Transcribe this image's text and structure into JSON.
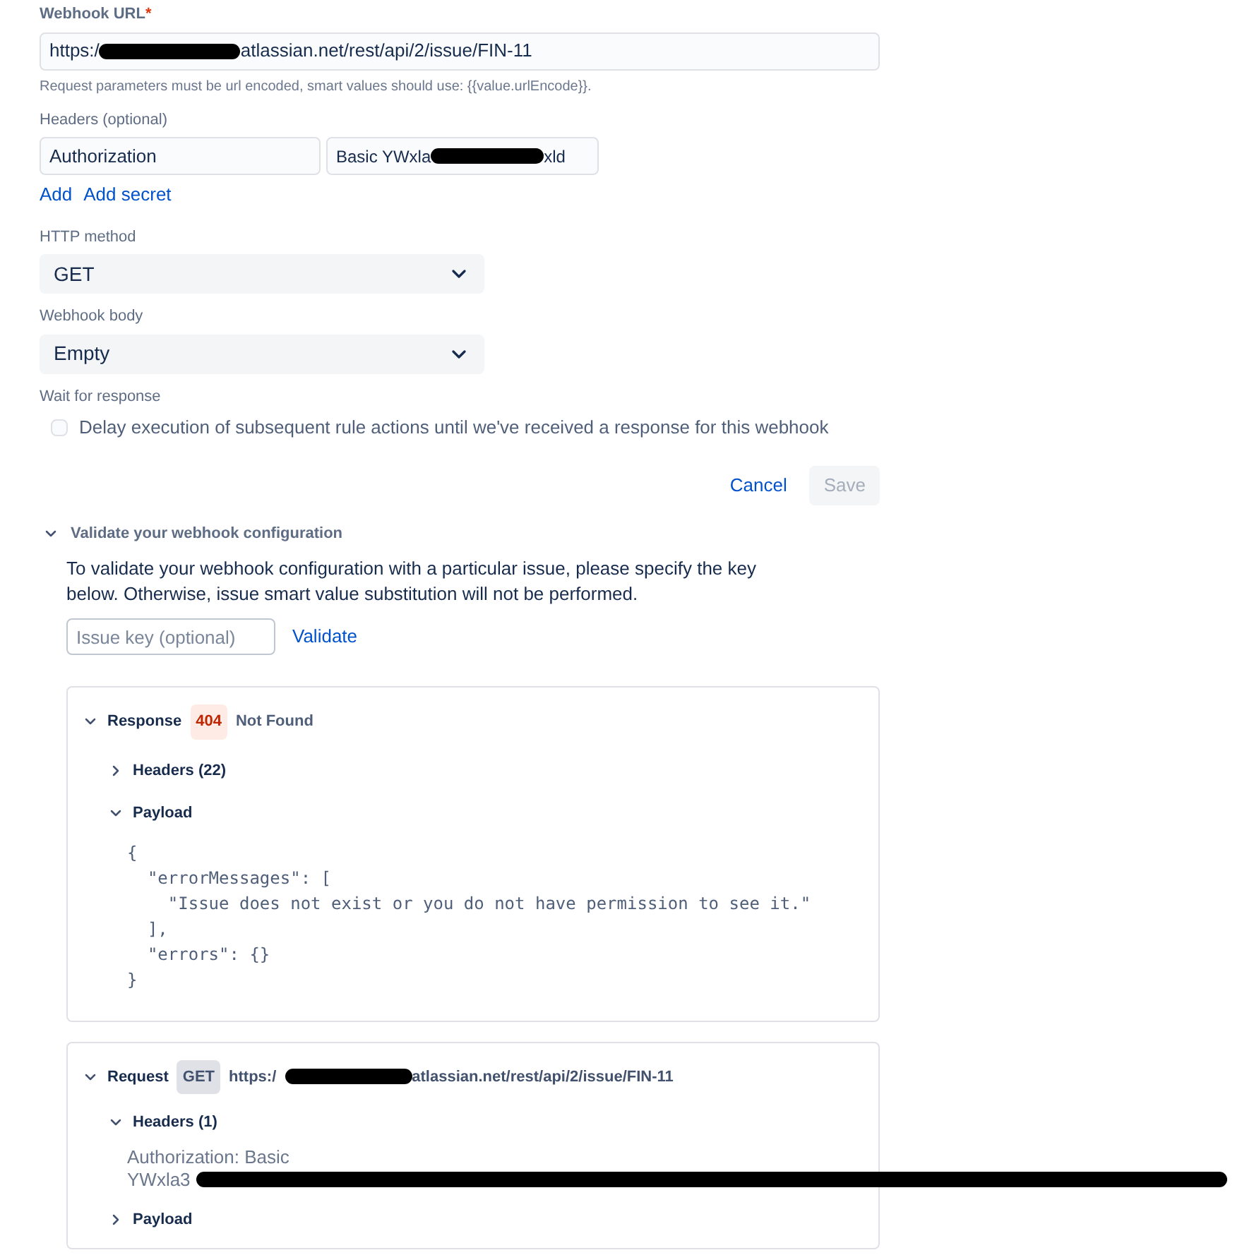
{
  "webhook_url": {
    "label": "Webhook URL",
    "required_mark": "*",
    "value_start": "https:/",
    "value_end": "atlassian.net/rest/api/2/issue/FIN-11",
    "help": "Request parameters must be url encoded, smart values should use: {{value.urlEncode}}."
  },
  "headers": {
    "label": "Headers (optional)",
    "name": "Authorization",
    "value_start": "Basic YWxla",
    "value_end": "xld",
    "links": [
      "Add",
      "Add secret"
    ]
  },
  "http_method": {
    "label": "HTTP method",
    "value": "GET"
  },
  "webhook_body": {
    "label": "Webhook body",
    "value": "Empty"
  },
  "wait": {
    "label": "Wait for response",
    "checkbox_label": "Delay execution of subsequent rule actions until we've received a response for this webhook",
    "checked": false
  },
  "actions": {
    "cancel": "Cancel",
    "save": "Save",
    "save_disabled": true
  },
  "validate": {
    "title": "Validate your webhook configuration",
    "expanded": true,
    "description": "To validate your webhook configuration with a particular issue, please specify the key below. Otherwise, issue smart value substitution will not be performed.",
    "placeholder": "Issue key (optional)",
    "button": "Validate"
  },
  "response": {
    "label": "Response",
    "expanded": true,
    "status_code": "404",
    "status_text": "Not Found",
    "sections": [
      {
        "label": "Headers (22)",
        "expanded": false
      },
      {
        "label": "Payload",
        "expanded": true,
        "lines": [
          "{",
          "  \"errorMessages\": [",
          "    \"Issue does not exist or you do not have permission to see it.\"",
          "  ],",
          "  \"errors\": {}",
          "}"
        ]
      }
    ]
  },
  "request": {
    "label": "Request",
    "expanded": true,
    "method": "GET",
    "url_start": "https:/",
    "url_end": "atlassian.net/rest/api/2/issue/FIN-11",
    "sections": [
      {
        "label": "Headers (1)",
        "expanded": true,
        "text_line": "Authorization: Basic",
        "value_start": "YWxla3"
      },
      {
        "label": "Payload",
        "expanded": false
      }
    ]
  }
}
